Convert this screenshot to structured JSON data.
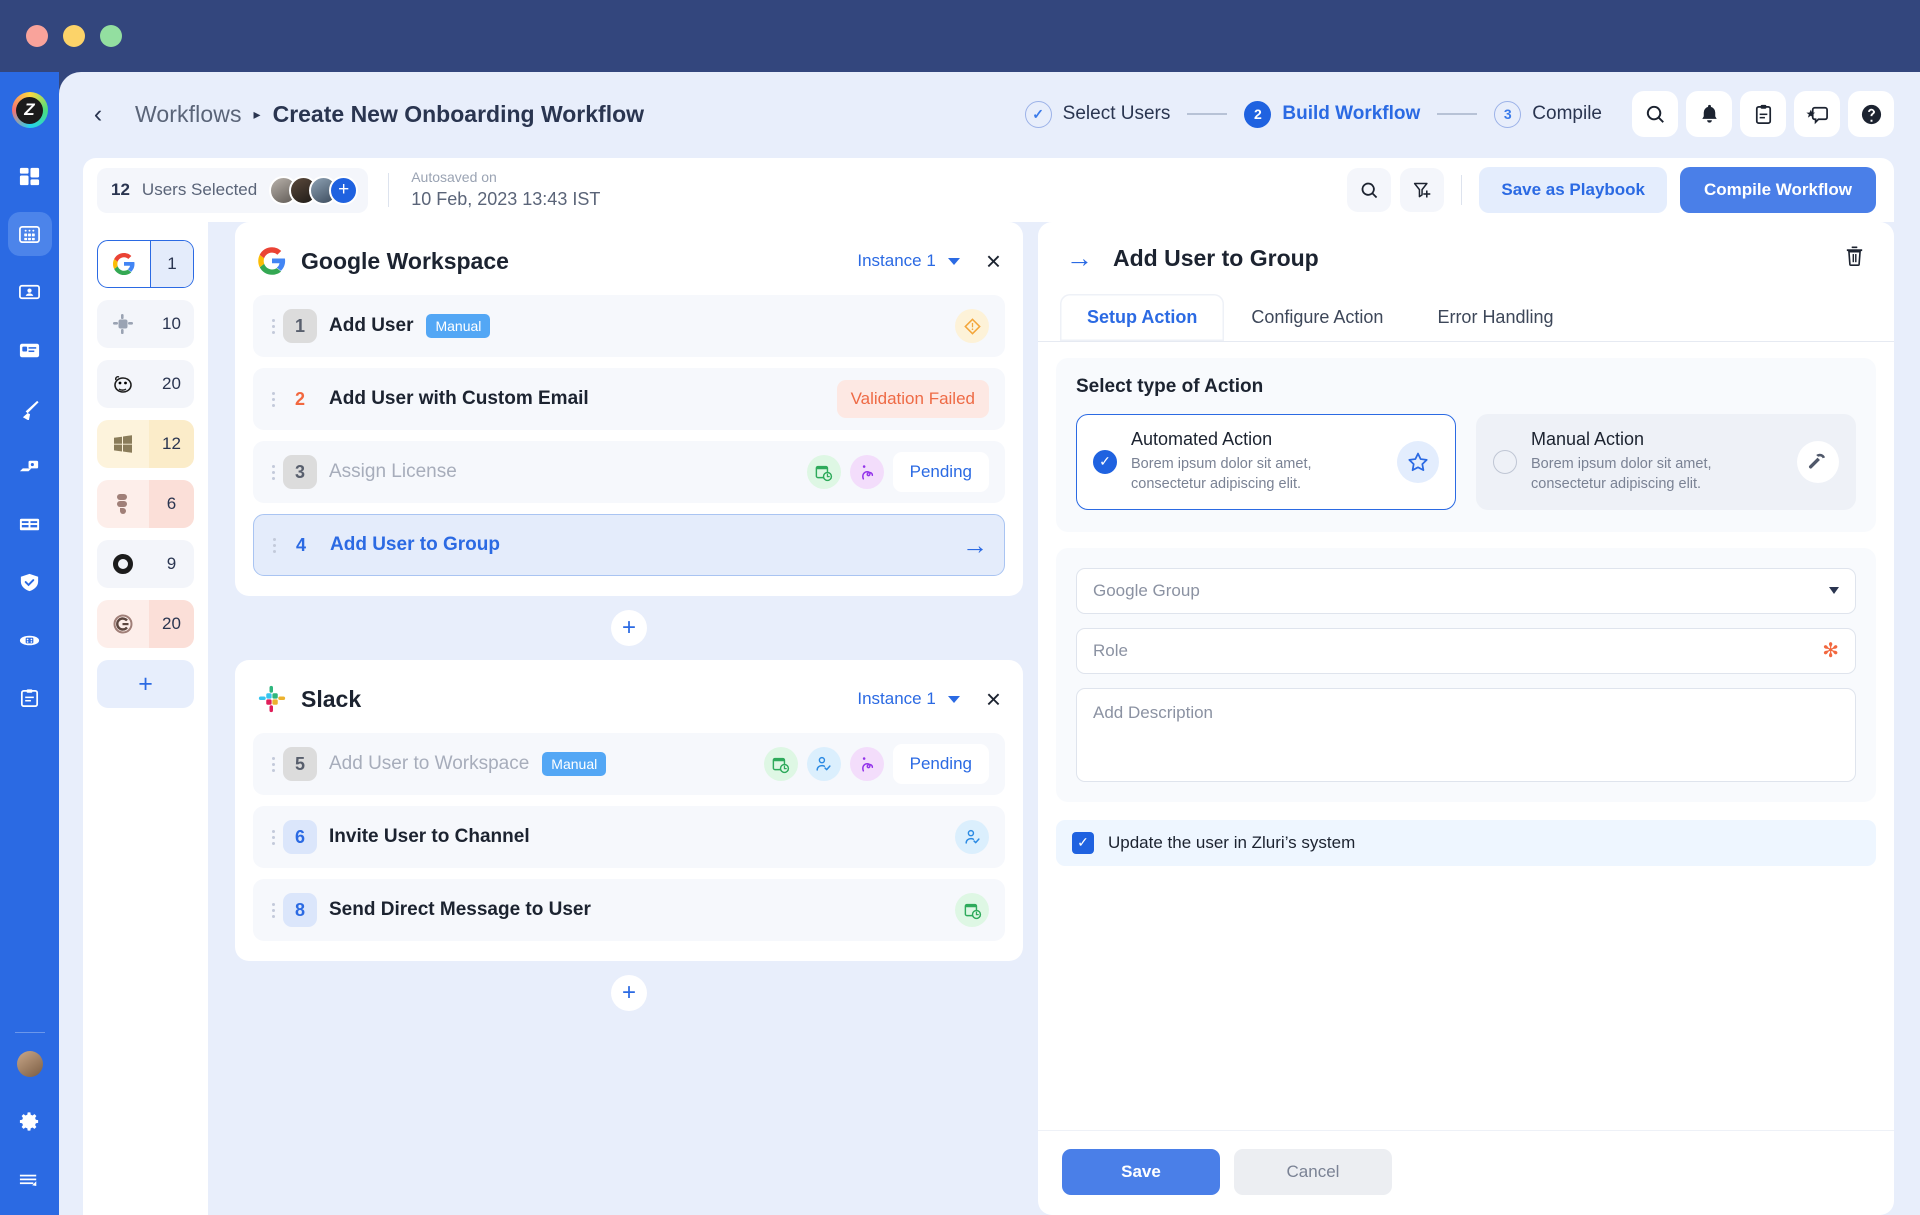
{
  "window": {
    "dots": [
      "close",
      "minimize",
      "maximize"
    ]
  },
  "header": {
    "back_icon": "chevron-left-icon",
    "breadcrumb_root": "Workflows",
    "breadcrumb_sep": "▸",
    "breadcrumb_current": "Create New Onboarding Workflow",
    "steps": [
      {
        "badge": "✓",
        "label": "Select Users",
        "state": "done"
      },
      {
        "badge": "2",
        "label": "Build Workflow",
        "state": "active"
      },
      {
        "badge": "3",
        "label": "Compile",
        "state": "todo"
      }
    ],
    "icons": [
      "search-icon",
      "bell-icon",
      "clipboard-icon",
      "feedback-icon",
      "help-icon"
    ]
  },
  "toolbar": {
    "users_count": "12",
    "users_label": "Users Selected",
    "add_user_label": "+",
    "autosaved_label": "Autosaved on",
    "autosaved_value": "10 Feb, 2023  13:43  IST",
    "search_icon": "search-icon",
    "filter_icon": "filter-add-icon",
    "playbook_label": "Save as Playbook",
    "compile_label": "Compile Workflow"
  },
  "app_column": {
    "apps": [
      {
        "name": "Google",
        "count": "1",
        "selected": true,
        "tint": ""
      },
      {
        "name": "Slack",
        "count": "10",
        "selected": false,
        "tint": ""
      },
      {
        "name": "Mailchimp",
        "count": "20",
        "selected": false,
        "tint": ""
      },
      {
        "name": "Microsoft",
        "count": "12",
        "selected": false,
        "tint": "yellow"
      },
      {
        "name": "Figma",
        "count": "6",
        "selected": false,
        "tint": "red"
      },
      {
        "name": "Notion",
        "count": "9",
        "selected": false,
        "tint": ""
      },
      {
        "name": "Clockify",
        "count": "20",
        "selected": false,
        "tint": "red"
      }
    ],
    "add_label": "+"
  },
  "cards": [
    {
      "title": "Google Workspace",
      "instance": "Instance 1",
      "close": "×",
      "rows": [
        {
          "num": "1",
          "num_style": "grey",
          "label": "Add User",
          "label_style": "",
          "tag": "Manual",
          "status": "",
          "icons": [
            "warning-diamond-icon"
          ]
        },
        {
          "num": "2",
          "num_style": "red",
          "label": "Add User with Custom Email",
          "label_style": "",
          "tag": "",
          "status": "Validation Failed",
          "icons": []
        },
        {
          "num": "3",
          "num_style": "grey",
          "label": "Assign License",
          "label_style": "muted",
          "tag": "",
          "status": "Pending",
          "icons": [
            "schedule-icon",
            "condition-icon"
          ]
        },
        {
          "num": "4",
          "num_style": "plain",
          "label": "Add User to Group",
          "label_style": "link",
          "tag": "",
          "status": "",
          "icons": [
            "arrow-right-icon"
          ]
        }
      ]
    },
    {
      "title": "Slack",
      "instance": "Instance 1",
      "close": "×",
      "rows": [
        {
          "num": "5",
          "num_style": "grey",
          "label": "Add User to Workspace",
          "label_style": "muted",
          "tag": "Manual",
          "status": "Pending",
          "icons": [
            "schedule-icon",
            "approval-icon",
            "condition-icon"
          ]
        },
        {
          "num": "6",
          "num_style": "blue",
          "label": "Invite User to Channel",
          "label_style": "",
          "tag": "",
          "status": "",
          "icons": [
            "approval-icon"
          ]
        },
        {
          "num": "8",
          "num_style": "blue",
          "label": "Send Direct Message to User",
          "label_style": "",
          "tag": "",
          "status": "",
          "icons": [
            "schedule-icon"
          ]
        }
      ]
    }
  ],
  "add_step_label": "+",
  "panel": {
    "arrow_icon": "arrow-right-icon",
    "title": "Add User to Group",
    "delete_icon": "trash-icon",
    "tabs": [
      {
        "label": "Setup Action",
        "active": true
      },
      {
        "label": "Configure Action",
        "active": false
      },
      {
        "label": "Error Handling",
        "active": false
      }
    ],
    "section_title": "Select type of Action",
    "options": [
      {
        "name": "Automated Action",
        "desc": "Borem ipsum dolor sit amet, consectetur adipiscing elit.",
        "selected": true,
        "icon": "star-icon"
      },
      {
        "name": "Manual Action",
        "desc": "Borem ipsum dolor sit amet, consectetur adipiscing elit.",
        "selected": false,
        "icon": "hammer-icon"
      }
    ],
    "fields": {
      "group_placeholder": "Google Group",
      "role_placeholder": "Role",
      "role_required_mark": "✻",
      "description_placeholder": "Add Description"
    },
    "checkbox": {
      "checked": true,
      "label": "Update the user in Zluri’s system",
      "mark": "✓"
    },
    "save_label": "Save",
    "cancel_label": "Cancel"
  },
  "colors": {
    "titlebar": "#33467d",
    "rail": "#2b6ae3",
    "accent": "#2b6ae3",
    "canvas": "#e8eefb",
    "danger": "#ee6a45",
    "warning": "#f3a53a"
  }
}
